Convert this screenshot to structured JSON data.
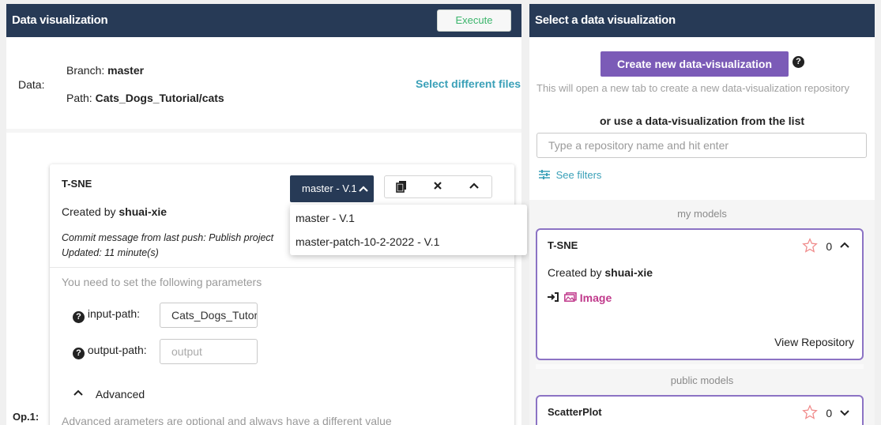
{
  "left": {
    "title": "Data visualization",
    "execute_label": "Execute",
    "data_label": "Data:",
    "branch_label": "Branch:",
    "branch_value": "master",
    "path_label": "Path:",
    "path_value": "Cats_Dogs_Tutorial/cats",
    "select_files": "Select different files",
    "op_label": "Op.1:",
    "card": {
      "title": "T-SNE",
      "created_label": "Created by",
      "created_user": "shuai-xie",
      "commit": "Commit message from last push: Publish project",
      "updated": "Updated: 11 minute(s)",
      "branch_btn": "master - V.1",
      "params_note": "You need to set the following parameters",
      "params": [
        {
          "label": "input-path:",
          "value": "Cats_Dogs_Tutorial/cats",
          "placeholder": ""
        },
        {
          "label": "output-path:",
          "value": "",
          "placeholder": "output"
        }
      ],
      "advanced": "Advanced",
      "advanced_note": "Advanced arameters are optional and always have a different value"
    },
    "dropdown": [
      "master - V.1",
      "master-patch-10-2-2022 - V.1"
    ]
  },
  "right": {
    "title": "Select a data visualization",
    "create_btn": "Create new data-visualization",
    "hint": "This will open a new tab to create a new data-visualization repository",
    "use_list": "or use a data-visualization from the list",
    "search_placeholder": "Type a repository name and hit enter",
    "filters": "See filters",
    "my_models_label": "my models",
    "public_models_label": "public models",
    "my_model": {
      "title": "T-SNE",
      "stars": "0",
      "created_label": "Created by",
      "created_user": "shuai-xie",
      "data_type": "Image",
      "view_repo": "View Repository"
    },
    "public_model": {
      "title": "ScatterPlot",
      "stars": "0"
    }
  },
  "colors": {
    "header": "#273a56",
    "accent_purple": "#7b5bb7",
    "link_teal": "#3aa0b8",
    "execute_green": "#3bb56b",
    "image_pink": "#c0398b"
  }
}
